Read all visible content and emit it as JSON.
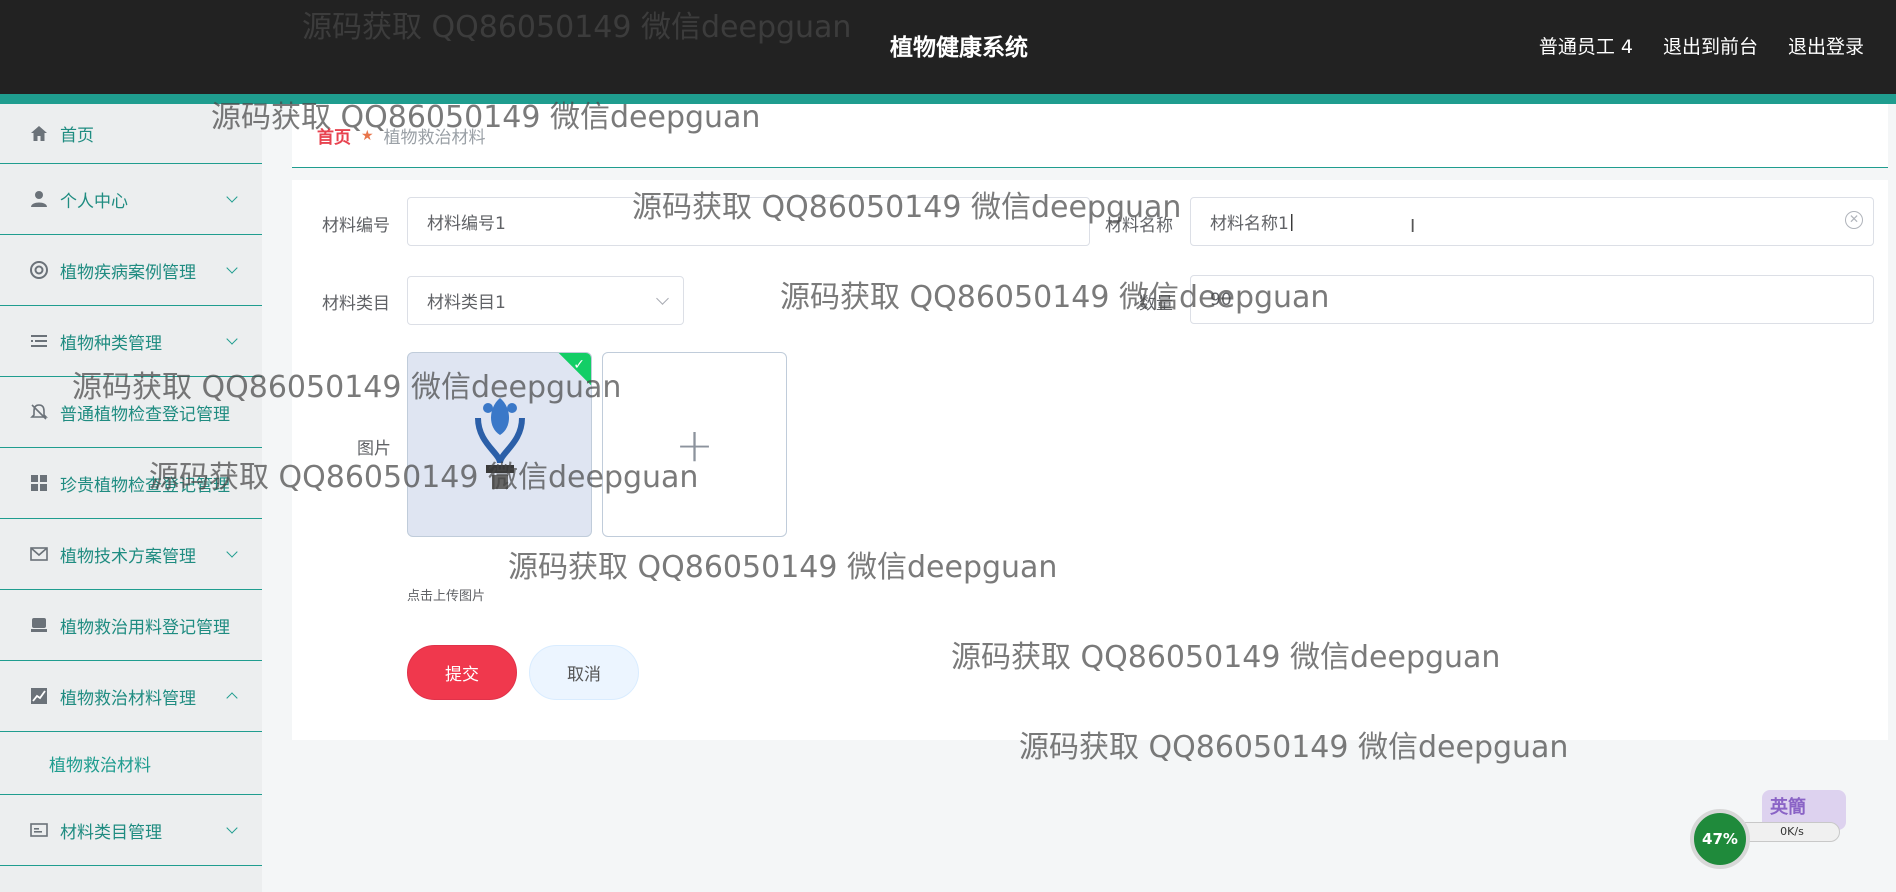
{
  "header": {
    "title": "植物健康系统",
    "links": [
      "普通员工 4",
      "退出到前台",
      "退出登录"
    ]
  },
  "sidebar": {
    "items": [
      {
        "label": "首页",
        "icon": "home-icon"
      },
      {
        "label": "个人中心",
        "icon": "user-icon"
      },
      {
        "label": "植物疾病案例管理",
        "icon": "lifebuoy-icon"
      },
      {
        "label": "植物种类管理",
        "icon": "list-icon"
      },
      {
        "label": "普通植物检查登记管理",
        "icon": "bell-off-icon"
      },
      {
        "label": "珍贵植物检查登记管理",
        "icon": "grid-icon"
      },
      {
        "label": "植物技术方案管理",
        "icon": "mail-icon"
      },
      {
        "label": "植物救治用料登记管理",
        "icon": "tray-icon"
      },
      {
        "label": "植物救治材料管理",
        "icon": "chart-icon"
      },
      {
        "label": "材料类目管理",
        "icon": "card-icon"
      }
    ],
    "submenu": "植物救治材料"
  },
  "breadcrumb": {
    "home": "首页",
    "current": "植物救治材料"
  },
  "form": {
    "code_label": "材料编号",
    "code_value": "材料编号1",
    "name_label": "材料名称",
    "name_value": "材料名称1",
    "category_label": "材料类目",
    "category_value": "材料类目1",
    "quantity_label": "数量",
    "quantity_value": "90",
    "image_label": "图片",
    "upload_tip": "点击上传图片",
    "submit": "提交",
    "cancel": "取消"
  },
  "watermark": "源码获取 QQ86050149 微信deepguan",
  "widget": {
    "percent": "47%",
    "speed": "0K/s",
    "ime": "英簡"
  },
  "colors": {
    "accent": "#1f9d8f",
    "submit": "#f0384d",
    "header": "#222222"
  }
}
